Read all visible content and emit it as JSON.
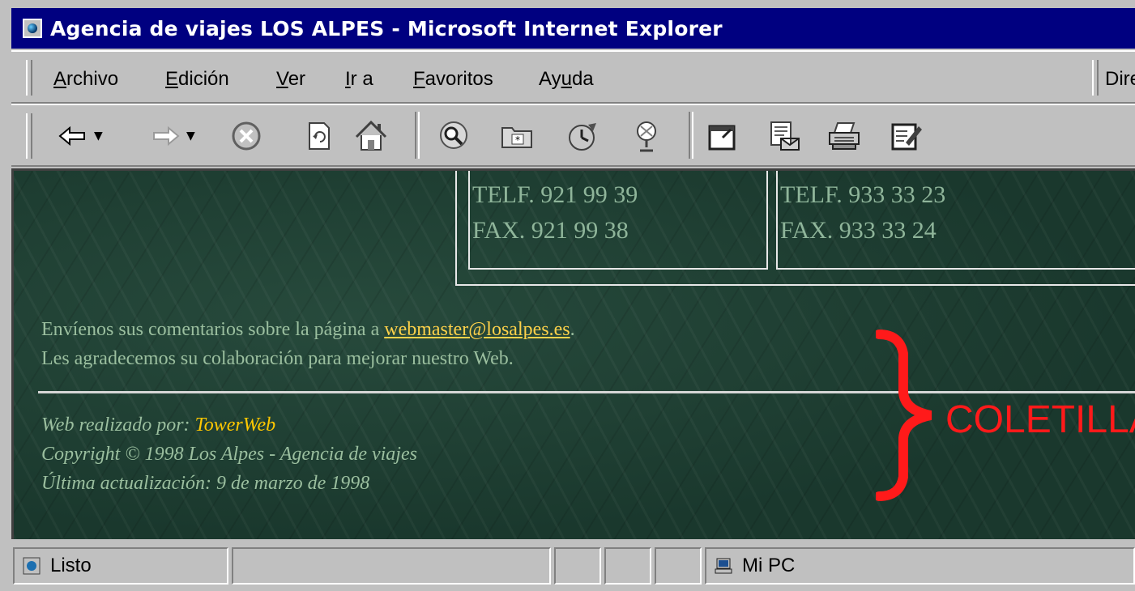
{
  "window": {
    "title": "Agencia de viajes LOS ALPES - Microsoft Internet Explorer",
    "icon": "ie-page-icon"
  },
  "menu": {
    "items": [
      {
        "label": "Archivo",
        "ul": "A",
        "rest": "rchivo"
      },
      {
        "label": "Edición",
        "ul": "E",
        "rest": "dición"
      },
      {
        "label": "Ver",
        "ul": "V",
        "rest": "er"
      },
      {
        "label": "Ir a",
        "ul": "I",
        "rest": "r a"
      },
      {
        "label": "Favoritos",
        "ul": "F",
        "rest": "avoritos"
      },
      {
        "label": "Ayuda",
        "pre": "Ay",
        "ul": "u",
        "rest": "da"
      }
    ],
    "address_label": "Dire"
  },
  "toolbar": {
    "buttons": [
      "back-icon",
      "forward-icon",
      "stop-icon",
      "refresh-icon",
      "home-icon",
      "search-icon",
      "favorites-icon",
      "history-icon",
      "channels-icon",
      "fullscreen-icon",
      "mail-icon",
      "print-icon",
      "edit-icon"
    ]
  },
  "content": {
    "offices": [
      {
        "phone": "TELF. 921 99 39",
        "fax": "FAX. 921 99 38"
      },
      {
        "phone": "TELF. 933 33 23",
        "fax": "FAX. 933 33 24"
      }
    ],
    "contact_prefix": "Envíenos sus comentarios sobre la página a",
    "contact_email": "webmaster@losalpes.es",
    "contact_suffix": ".",
    "thanks": "Les agradecemos su colaboración para mejorar nuestro Web.",
    "made_by_label": "Web realizado por:",
    "made_by": "TowerWeb",
    "copyright": "Copyright © 1998 Los Alpes - Agencia de viajes",
    "updated": "Última actualización: 9 de marzo de 1998",
    "annotation": "COLETILLA",
    "annotation_color": "#ff1a1a"
  },
  "status": {
    "text": "Listo",
    "zone": "Mi PC"
  }
}
